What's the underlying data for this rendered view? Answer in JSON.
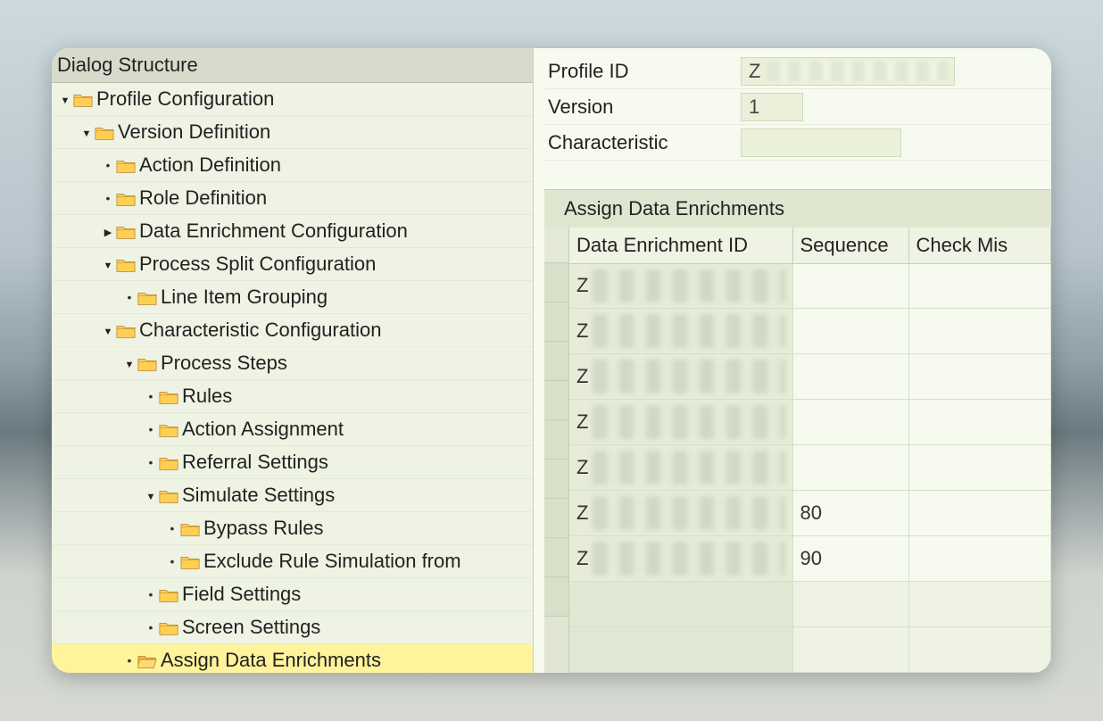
{
  "tree": {
    "header": "Dialog Structure",
    "items": [
      {
        "label": "Profile Configuration",
        "level": 0,
        "state": "expanded",
        "selected": false
      },
      {
        "label": "Version Definition",
        "level": 1,
        "state": "expanded",
        "selected": false
      },
      {
        "label": "Action Definition",
        "level": 2,
        "state": "leaf",
        "selected": false
      },
      {
        "label": "Role Definition",
        "level": 2,
        "state": "leaf",
        "selected": false
      },
      {
        "label": "Data Enrichment Configuration",
        "level": 2,
        "state": "collapsed",
        "selected": false
      },
      {
        "label": "Process Split Configuration",
        "level": 2,
        "state": "expanded",
        "selected": false
      },
      {
        "label": "Line Item Grouping",
        "level": 3,
        "state": "leaf",
        "selected": false
      },
      {
        "label": "Characteristic Configuration",
        "level": 2,
        "state": "expanded",
        "selected": false
      },
      {
        "label": "Process Steps",
        "level": 3,
        "state": "expanded",
        "selected": false
      },
      {
        "label": "Rules",
        "level": 4,
        "state": "leaf",
        "selected": false
      },
      {
        "label": "Action Assignment",
        "level": 4,
        "state": "leaf",
        "selected": false
      },
      {
        "label": "Referral Settings",
        "level": 4,
        "state": "leaf",
        "selected": false
      },
      {
        "label": "Simulate Settings",
        "level": 4,
        "state": "expanded",
        "selected": false
      },
      {
        "label": "Bypass Rules",
        "level": 4,
        "state": "leaf",
        "selected": false,
        "extraIndent": 1
      },
      {
        "label": "Exclude Rule Simulation from",
        "level": 4,
        "state": "leaf",
        "selected": false,
        "extraIndent": 1
      },
      {
        "label": "Field Settings",
        "level": 4,
        "state": "leaf",
        "selected": false
      },
      {
        "label": "Screen Settings",
        "level": 4,
        "state": "leaf",
        "selected": false
      },
      {
        "label": "Assign Data Enrichments",
        "level": 3,
        "state": "leaf",
        "selected": true,
        "open": true
      }
    ]
  },
  "form": {
    "profile_id_label": "Profile ID",
    "profile_id_value": "Z",
    "version_label": "Version",
    "version_value": "1",
    "characteristic_label": "Characteristic",
    "characteristic_value": ""
  },
  "section": {
    "title": "Assign Data Enrichments"
  },
  "table": {
    "columns": [
      "Data Enrichment ID",
      "Sequence",
      "Check Mis"
    ],
    "rows": [
      {
        "id_prefix": "Z",
        "sequence": "",
        "check": ""
      },
      {
        "id_prefix": "Z",
        "sequence": "",
        "check": ""
      },
      {
        "id_prefix": "Z",
        "sequence": "",
        "check": ""
      },
      {
        "id_prefix": "Z",
        "sequence": "",
        "check": ""
      },
      {
        "id_prefix": "Z",
        "sequence": "",
        "check": ""
      },
      {
        "id_prefix": "Z",
        "sequence": "80",
        "check": ""
      },
      {
        "id_prefix": "Z",
        "sequence": "90",
        "check": ""
      }
    ],
    "empty_rows": 2
  }
}
